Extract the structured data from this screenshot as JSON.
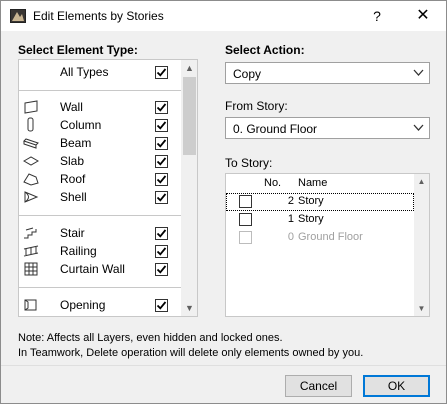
{
  "window": {
    "title": "Edit Elements by Stories",
    "help_label": "?",
    "close_label": "✕"
  },
  "left": {
    "heading": "Select Element Type:",
    "items": [
      {
        "label": "All Types",
        "checked": true,
        "icon": ""
      },
      {
        "label": "Wall",
        "checked": true,
        "icon": "wall-icon"
      },
      {
        "label": "Column",
        "checked": true,
        "icon": "column-icon"
      },
      {
        "label": "Beam",
        "checked": true,
        "icon": "beam-icon"
      },
      {
        "label": "Slab",
        "checked": true,
        "icon": "slab-icon"
      },
      {
        "label": "Roof",
        "checked": true,
        "icon": "roof-icon"
      },
      {
        "label": "Shell",
        "checked": true,
        "icon": "shell-icon"
      },
      {
        "label": "Stair",
        "checked": true,
        "icon": "stair-icon"
      },
      {
        "label": "Railing",
        "checked": true,
        "icon": "railing-icon"
      },
      {
        "label": "Curtain Wall",
        "checked": true,
        "icon": "curtain-wall-icon"
      },
      {
        "label": "Opening",
        "checked": true,
        "icon": "opening-icon"
      }
    ]
  },
  "right": {
    "action_heading": "Select Action:",
    "action_value": "Copy",
    "from_heading": "From Story:",
    "from_value": "0. Ground Floor",
    "to_heading": "To Story:",
    "table": {
      "col_no": "No.",
      "col_name": "Name",
      "rows": [
        {
          "no": "2",
          "name": "Story",
          "checked": false,
          "disabled": false,
          "selected": true
        },
        {
          "no": "1",
          "name": "Story",
          "checked": false,
          "disabled": false,
          "selected": false
        },
        {
          "no": "0",
          "name": "Ground Floor",
          "checked": false,
          "disabled": true,
          "selected": false
        }
      ]
    }
  },
  "note": {
    "line1": "Note: Affects all Layers, even hidden and locked ones.",
    "line2": "In Teamwork, Delete operation will delete only elements owned by you."
  },
  "buttons": {
    "cancel": "Cancel",
    "ok": "OK"
  }
}
